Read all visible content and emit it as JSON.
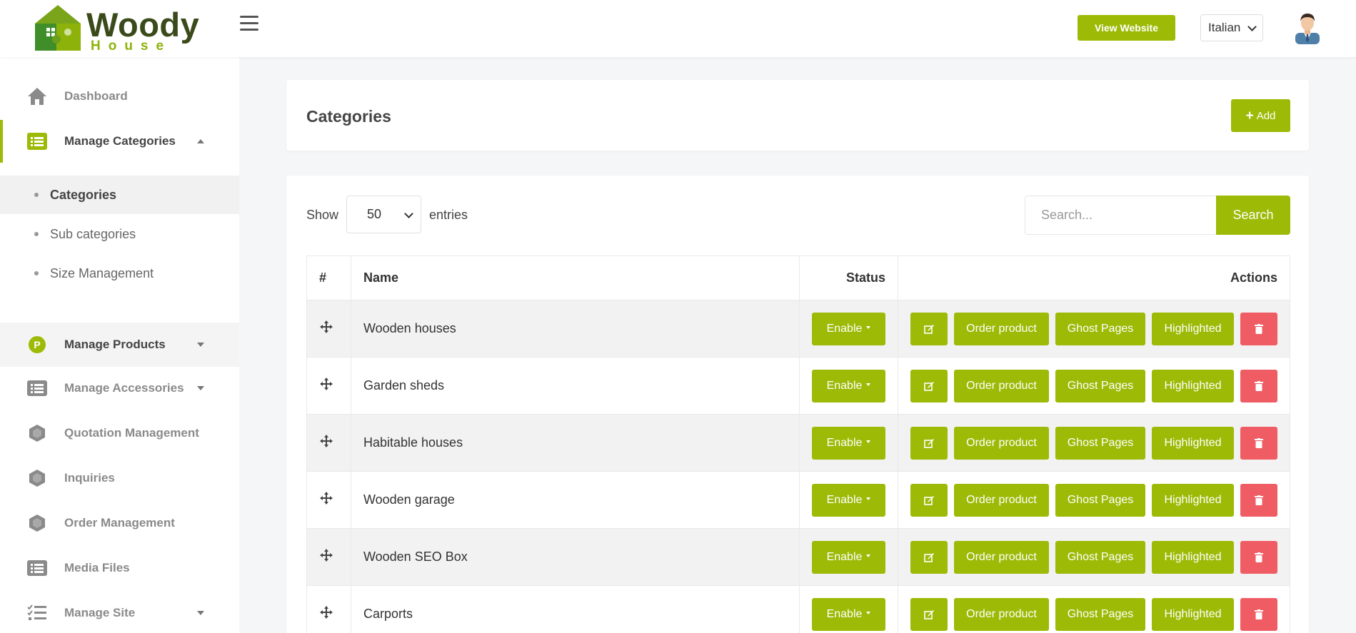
{
  "header": {
    "logo_text": "Woody",
    "logo_subtext": "House",
    "view_website_label": "View Website",
    "language": "Italian"
  },
  "sidebar": {
    "items": [
      {
        "label": "Dashboard",
        "icon": "home-icon"
      },
      {
        "label": "Manage Categories",
        "icon": "list-icon",
        "expanded": true
      },
      {
        "label": "Manage Products",
        "icon": "p-badge-icon"
      },
      {
        "label": "Manage Accessories",
        "icon": "list-icon"
      },
      {
        "label": "Quotation Management",
        "icon": "hexagon-icon"
      },
      {
        "label": "Inquiries",
        "icon": "hexagon-icon"
      },
      {
        "label": "Order Management",
        "icon": "hexagon-icon"
      },
      {
        "label": "Media Files",
        "icon": "list-icon"
      },
      {
        "label": "Manage Site",
        "icon": "checklist-icon"
      }
    ],
    "subitems": [
      {
        "label": "Categories",
        "active": true
      },
      {
        "label": "Sub categories"
      },
      {
        "label": "Size Management"
      }
    ]
  },
  "page": {
    "title": "Categories",
    "add_label": "Add"
  },
  "table_controls": {
    "show_label": "Show",
    "entries_value": "50",
    "entries_label": "entries",
    "search_placeholder": "Search...",
    "search_button": "Search"
  },
  "table": {
    "columns": [
      "#",
      "Name",
      "Status",
      "Actions"
    ],
    "rows": [
      {
        "name": "Wooden houses",
        "status": "Enable"
      },
      {
        "name": "Garden sheds",
        "status": "Enable"
      },
      {
        "name": "Habitable houses",
        "status": "Enable"
      },
      {
        "name": "Wooden garage",
        "status": "Enable"
      },
      {
        "name": "Wooden SEO Box",
        "status": "Enable"
      },
      {
        "name": "Carports",
        "status": "Enable"
      }
    ],
    "action_labels": {
      "order": "Order product",
      "ghost": "Ghost Pages",
      "highlighted": "Highlighted"
    }
  },
  "colors": {
    "accent": "#9dba06",
    "danger": "#ef5c64"
  }
}
